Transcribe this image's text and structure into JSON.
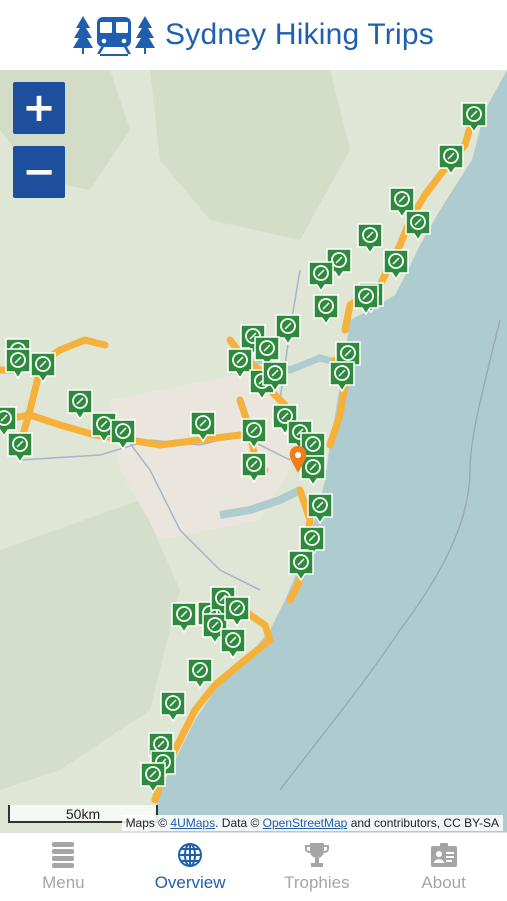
{
  "app": {
    "title": "Sydney Hiking Trips"
  },
  "map": {
    "zoom_in_label": "+",
    "zoom_out_label": "−",
    "scale_label": "50km",
    "attribution": {
      "prefix": "Maps © ",
      "link1": "4UMaps",
      "mid": ". Data © ",
      "link2": "OpenStreetMap",
      "suffix": " and contributors, CC BY-SA"
    },
    "colors": {
      "sea": "#aecbd0",
      "land": "#dfe6d6",
      "trail": "#f5b13a",
      "marker": "#2e8b3e",
      "current_location": "#f07d1a"
    }
  },
  "tabs": [
    {
      "label": "Menu",
      "icon": "menu-stack-icon",
      "active": false
    },
    {
      "label": "Overview",
      "icon": "globe-icon",
      "active": true
    },
    {
      "label": "Trophies",
      "icon": "trophy-icon",
      "active": false
    },
    {
      "label": "About",
      "icon": "id-card-icon",
      "active": false
    }
  ]
}
